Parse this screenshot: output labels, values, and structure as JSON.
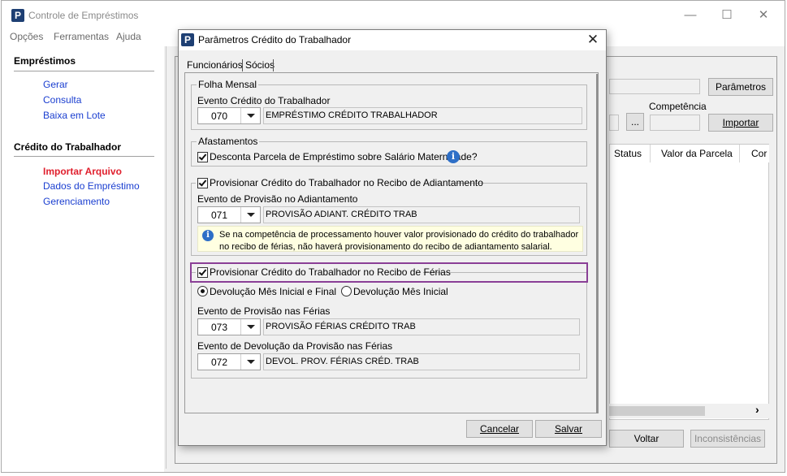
{
  "app": {
    "title": "Controle de Empréstimos",
    "logo_letter": "P",
    "window_controls": {
      "minimize": "—",
      "maximize": "☐",
      "close": "✕"
    }
  },
  "menu": [
    "Opções",
    "Ferramentas",
    "Ajuda"
  ],
  "sidebar": {
    "sections": [
      {
        "title": "Empréstimos",
        "items": [
          "Gerar",
          "Consulta",
          "Baixa em Lote"
        ]
      },
      {
        "title": "Crédito do Trabalhador",
        "items": [
          "Importar Arquivo",
          "Dados do Empréstimo",
          "Gerenciamento"
        ]
      }
    ],
    "active_item": "Importar Arquivo"
  },
  "background": {
    "parametros_button": "Parâmetros",
    "competencia_label": "Competência",
    "browse_button": "...",
    "importar_button": "Importar",
    "grid_columns": [
      "Status",
      "Valor da Parcela",
      "Cor"
    ],
    "scroll_right": "›",
    "voltar_button": "Voltar",
    "inconsistencias_button": "Inconsistências"
  },
  "dialog": {
    "title": "Parâmetros Crédito do Trabalhador",
    "close": "✕",
    "tabs": [
      "Funcionários",
      "Sócios"
    ],
    "folha": {
      "group_title": "Folha Mensal",
      "evento_label": "Evento Crédito do Trabalhador",
      "evento_code": "070",
      "evento_desc": "EMPRÉSTIMO CRÉDITO TRABALHADOR"
    },
    "afastamentos": {
      "group_title": "Afastamentos",
      "checkbox_label": "Desconta Parcela de Empréstimo sobre Salário Maternidade?",
      "checked": true,
      "info_glyph": "i"
    },
    "adiantamento": {
      "checkbox_label": "Provisionar Crédito do Trabalhador no Recibo de Adiantamento",
      "checked": true,
      "evento_label": "Evento de Provisão no Adiantamento",
      "evento_code": "071",
      "evento_desc": "PROVISÃO ADIANT. CRÉDITO TRAB",
      "info_text": "Se na competência de processamento houver valor provisionado do crédito do trabalhador no recibo de férias, não haverá provisionamento do recibo de adiantamento salarial."
    },
    "ferias": {
      "checkbox_label": "Provisionar Crédito do Trabalhador no Recibo de Férias",
      "checked": true,
      "radio_options": [
        "Devolução Mês Inicial e Final",
        "Devolução Mês Inicial"
      ],
      "radio_selected": 0,
      "provisao_label": "Evento de Provisão nas Férias",
      "provisao_code": "073",
      "provisao_desc": "PROVISÃO FÉRIAS CRÉDITO TRAB",
      "devolucao_label": "Evento de Devolução da Provisão nas Férias",
      "devolucao_code": "072",
      "devolucao_desc": "DEVOL. PROV. FÉRIAS CRÉD. TRAB"
    },
    "buttons": {
      "cancel": "Cancelar",
      "save": "Salvar"
    }
  },
  "colors": {
    "link": "#1a3ed0",
    "active_link": "#e0202e",
    "highlight_border": "#8a3f96",
    "info_bg": "#ffffe1",
    "logo_bg": "#1e3f73"
  }
}
